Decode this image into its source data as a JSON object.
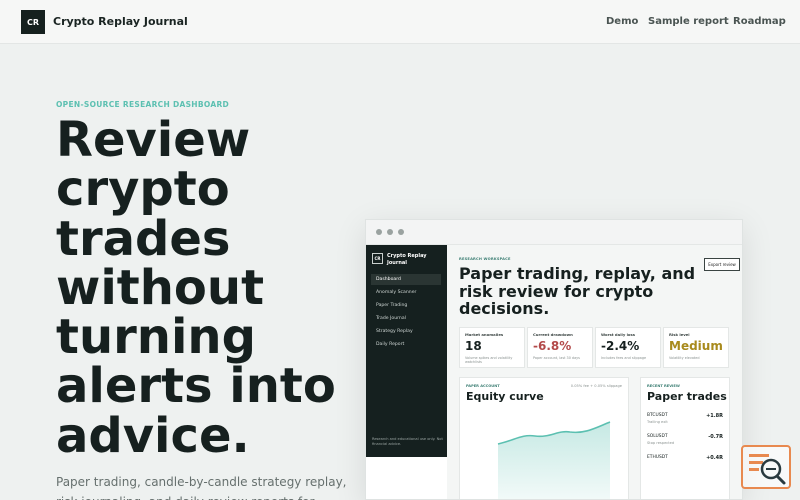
{
  "header": {
    "logo": "CR",
    "brand": "Crypto Replay Journal",
    "nav": [
      "Demo",
      "Sample report",
      "Roadmap"
    ]
  },
  "hero": {
    "eyebrow": "OPEN-SOURCE RESEARCH DASHBOARD",
    "title": "Review crypto trades without turning alerts into advice.",
    "subtitle": "Paper trading, candle-by-candle strategy replay, risk journaling, and daily review reports for"
  },
  "mockup": {
    "sidebar": {
      "logo": "CR",
      "brand": "Crypto Replay Journal",
      "items": [
        "Dashboard",
        "Anomaly Scanner",
        "Paper Trading",
        "Trade Journal",
        "Strategy Replay",
        "Daily Report"
      ],
      "active_index": 0,
      "footer": "Research and educational use only. Not financial advice."
    },
    "workspace": {
      "eyebrow": "RESEARCH WORKSPACE",
      "title": "Paper trading, replay, and risk review for crypto decisions.",
      "export_label": "Export review"
    },
    "stats": [
      {
        "label": "Market anomalies",
        "value": "18",
        "note": "Volume spikes and volatility watchlists",
        "color": "#16201f"
      },
      {
        "label": "Current drawdown",
        "value": "-6.8%",
        "note": "Paper account, last 30 days",
        "color": "#b34a4a"
      },
      {
        "label": "Worst daily loss",
        "value": "-2.4%",
        "note": "Includes fees and slippage",
        "color": "#16201f"
      },
      {
        "label": "Risk level",
        "value": "Medium",
        "note": "Volatility elevated",
        "color": "#a88a1c"
      }
    ],
    "equity": {
      "eyebrow": "PAPER ACCOUNT",
      "title": "Equity curve",
      "meta": "0.05% fee + 0.05% slippage"
    },
    "trades": {
      "eyebrow": "RECENT REVIEW",
      "title": "Paper trades",
      "rows": [
        {
          "symbol": "BTCUSDT",
          "note": "Trailing exit",
          "pnl": "+1.8R"
        },
        {
          "symbol": "SOLUSDT",
          "note": "Stop respected",
          "pnl": "-0.7R"
        },
        {
          "symbol": "ETHUSDT",
          "note": "",
          "pnl": "+0.4R"
        }
      ]
    }
  },
  "colors": {
    "accent": "#5cc0b1",
    "dark": "#15201f",
    "negative": "#b34a4a",
    "warning": "#a88a1c",
    "help_badge": "#e8894f"
  },
  "icons": {
    "help_badge": "search-help-icon"
  }
}
